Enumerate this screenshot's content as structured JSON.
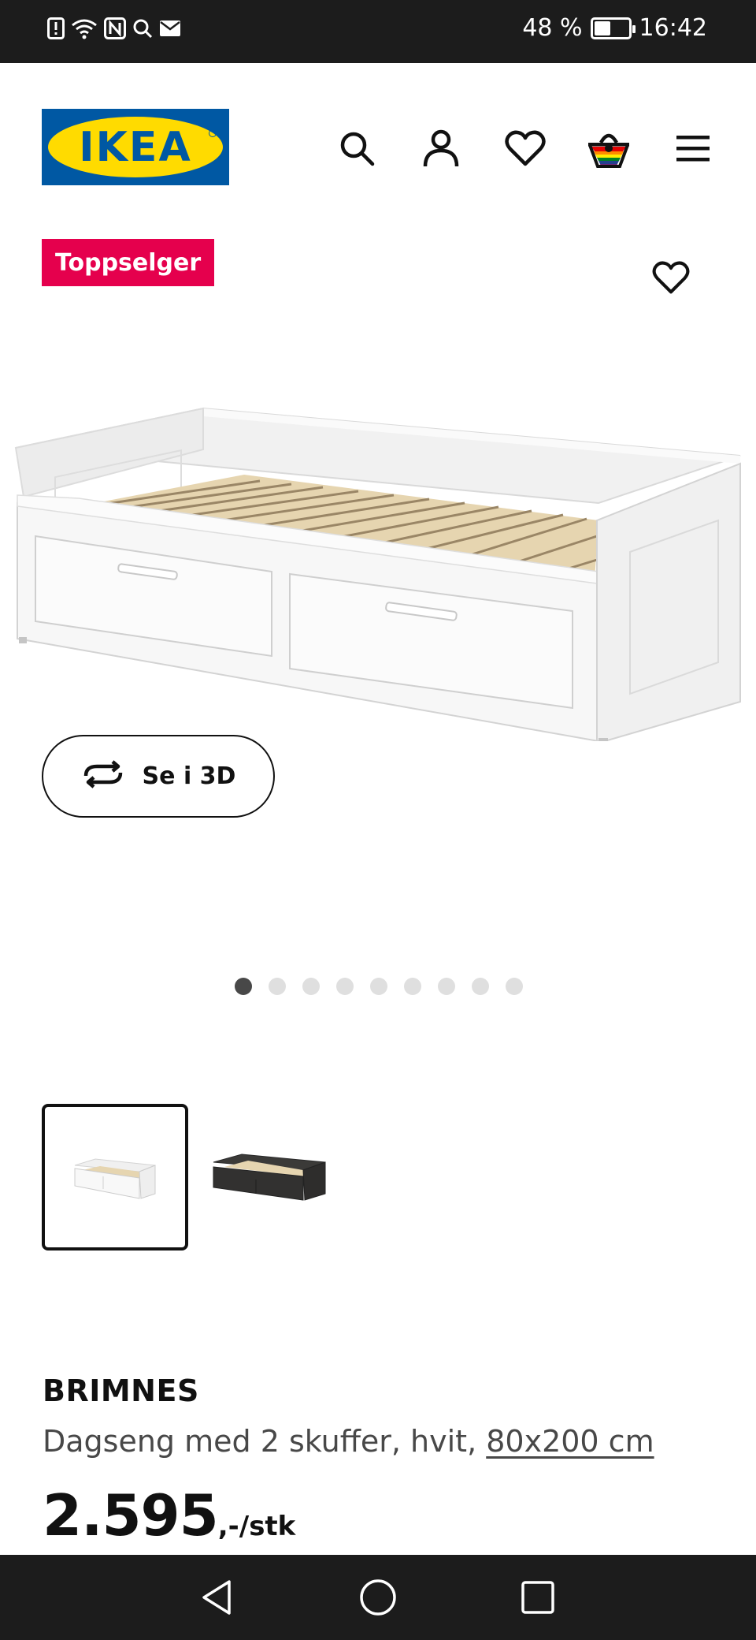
{
  "status_bar": {
    "battery_percent": "48 %",
    "battery_level": 0.48,
    "time": "16:42",
    "icons": [
      "sim-alert-icon",
      "wifi-icon",
      "nfc-icon",
      "search-icon",
      "mail-icon"
    ]
  },
  "header": {
    "logo_text": "IKEA",
    "icons": [
      "search-icon",
      "account-icon",
      "heart-icon",
      "basket-icon",
      "menu-icon"
    ]
  },
  "badge": {
    "label": "Toppselger"
  },
  "gallery": {
    "view_3d_label": "Se i 3D",
    "dot_count": 9,
    "active_dot": 0,
    "variants": [
      "white",
      "black-brown"
    ]
  },
  "product": {
    "name": "BRIMNES",
    "description": "Dagseng med 2 skuffer, hvit, ",
    "size_link": "80x200 cm",
    "price": "2.595",
    "price_suffix": ",-/stk"
  },
  "colors": {
    "ikea_blue": "#0058a3",
    "ikea_yellow": "#ffdb00",
    "badge_bg": "#e5004d",
    "bar_bg": "#1c1c1c"
  }
}
